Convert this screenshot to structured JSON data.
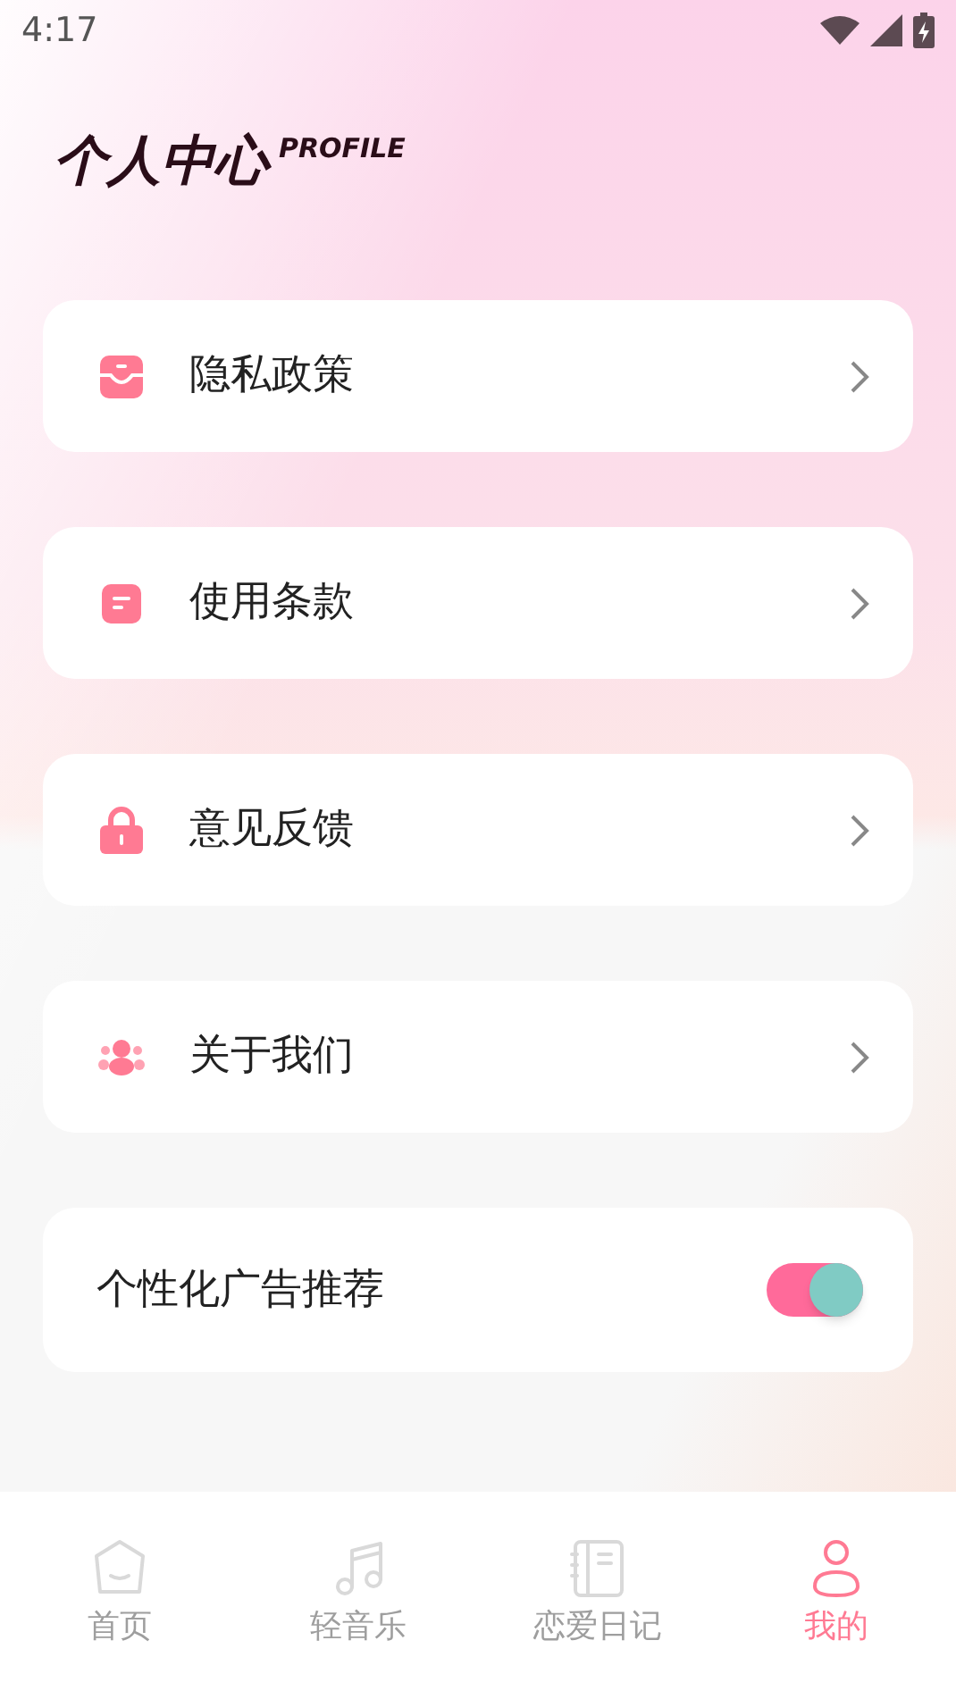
{
  "status_bar": {
    "time": "4:17"
  },
  "header": {
    "title": "个人中心",
    "subtitle": "PROFILE"
  },
  "menu": [
    {
      "kind": "privacy",
      "label": "隐私政策"
    },
    {
      "kind": "terms",
      "label": "使用条款"
    },
    {
      "kind": "feedback",
      "label": "意见反馈"
    },
    {
      "kind": "about",
      "label": "关于我们"
    }
  ],
  "ad_setting": {
    "label": "个性化广告推荐",
    "on": true
  },
  "tabs": [
    {
      "kind": "home",
      "label": "首页",
      "selected": false
    },
    {
      "kind": "music",
      "label": "轻音乐",
      "selected": false
    },
    {
      "kind": "diary",
      "label": "恋爱日记",
      "selected": false
    },
    {
      "kind": "profile",
      "label": "我的",
      "selected": true
    }
  ]
}
